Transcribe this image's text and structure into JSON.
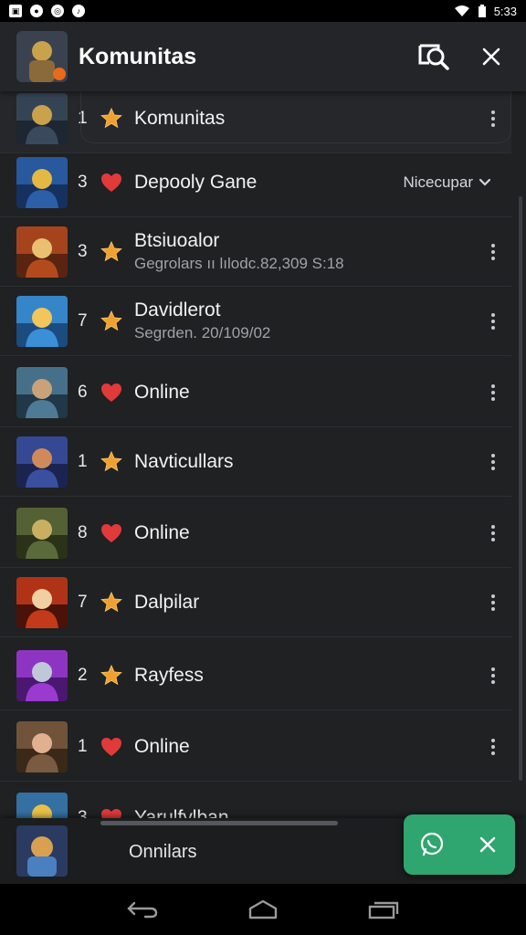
{
  "status_bar": {
    "time": "5:33"
  },
  "header": {
    "title": "Komunitas"
  },
  "list": {
    "items": [
      {
        "rank": "1",
        "badge": "star",
        "name": "Komunitas",
        "sub": "",
        "palette": [
          "#3a4a5c",
          "#1d2733",
          "#c9a24b"
        ]
      },
      {
        "rank": "3",
        "badge": "heart",
        "name": "Depooly Gane",
        "sub": "",
        "dropdown": "Nicecupar",
        "palette": [
          "#2b5fa8",
          "#163160",
          "#e3b843"
        ]
      },
      {
        "rank": "3",
        "badge": "star",
        "name": "Btsiuoalor",
        "sub": "Gegrolars ıı lılodc.82,309 S:18",
        "palette": [
          "#b34a1e",
          "#5a2410",
          "#e8c070"
        ]
      },
      {
        "rank": "7",
        "badge": "star",
        "name": "Davidlerot",
        "sub": "Segrden. 20/109/02",
        "palette": [
          "#3b8fd6",
          "#1a4c80",
          "#f2c65a"
        ]
      },
      {
        "rank": "6",
        "badge": "heart",
        "name": "Online",
        "sub": "",
        "palette": [
          "#4e7a96",
          "#203848",
          "#c9a27a"
        ]
      },
      {
        "rank": "1",
        "badge": "star",
        "name": "Navticullars",
        "sub": "",
        "palette": [
          "#3a4fa0",
          "#1b2450",
          "#d08a5a"
        ]
      },
      {
        "rank": "8",
        "badge": "heart",
        "name": "Online",
        "sub": "",
        "palette": [
          "#5a6a3a",
          "#2a3218",
          "#c8b060"
        ]
      },
      {
        "rank": "7",
        "badge": "star",
        "name": "Dalpilar",
        "sub": "",
        "palette": [
          "#c23a1a",
          "#4a1208",
          "#f0d0a0"
        ]
      },
      {
        "rank": "2",
        "badge": "star",
        "name": "Rayfess",
        "sub": "",
        "palette": [
          "#9a3ad0",
          "#4a1870",
          "#c0c8d8"
        ]
      },
      {
        "rank": "1",
        "badge": "heart",
        "name": "Online",
        "sub": "",
        "palette": [
          "#7a5a40",
          "#3a2818",
          "#e0b090"
        ]
      },
      {
        "rank": "3",
        "badge": "heart",
        "name": "Yarulfylban",
        "sub": "",
        "palette": [
          "#3a7ab0",
          "#183850",
          "#e8c048"
        ]
      }
    ]
  },
  "mini_player": {
    "label": "Onnilars"
  },
  "colors": {
    "background": "#1f2123",
    "accent": "#2fa66f",
    "star": "#f0a030",
    "heart": "#e03a3a"
  },
  "icons": {
    "header": [
      "search-icon",
      "close-icon"
    ],
    "fab": [
      "whatsapp-icon",
      "close-icon"
    ],
    "nav": [
      "back-icon",
      "home-icon",
      "recents-icon"
    ]
  }
}
